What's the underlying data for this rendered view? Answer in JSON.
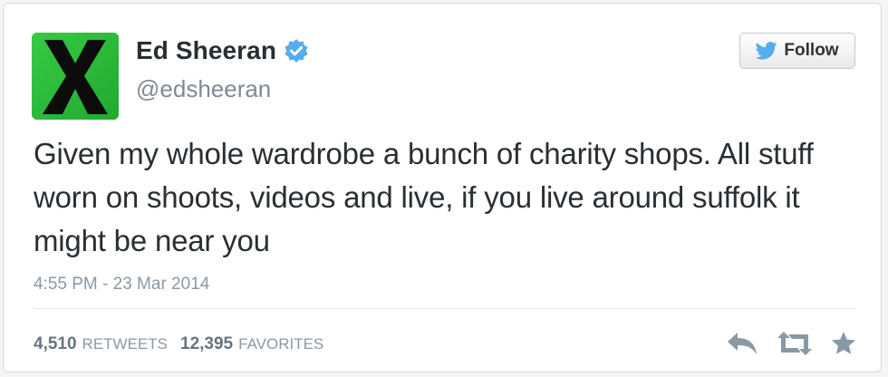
{
  "user": {
    "name": "Ed Sheeran",
    "handle": "@edsheeran",
    "avatar_icon": "x-album-avatar",
    "verified_icon": "verified-badge-icon"
  },
  "follow_button": {
    "label": "Follow",
    "icon": "twitter-bird-icon"
  },
  "tweet": {
    "text": "Given my whole wardrobe a bunch of charity shops. All stuff worn on shoots, videos and live, if you live around suffolk it might be near you",
    "timestamp": "4:55 PM - 23 Mar 2014"
  },
  "stats": {
    "retweets_count": "4,510",
    "retweets_label": "RETWEETS",
    "favorites_count": "12,395",
    "favorites_label": "FAVORITES"
  },
  "actions": [
    "reply-icon",
    "retweet-icon",
    "favorite-icon"
  ],
  "colors": {
    "verified_blue": "#55acee",
    "avatar_green": "#2dbf3a",
    "text": "#292f33",
    "muted": "#8899a6",
    "icon_gray": "#8899a6"
  }
}
